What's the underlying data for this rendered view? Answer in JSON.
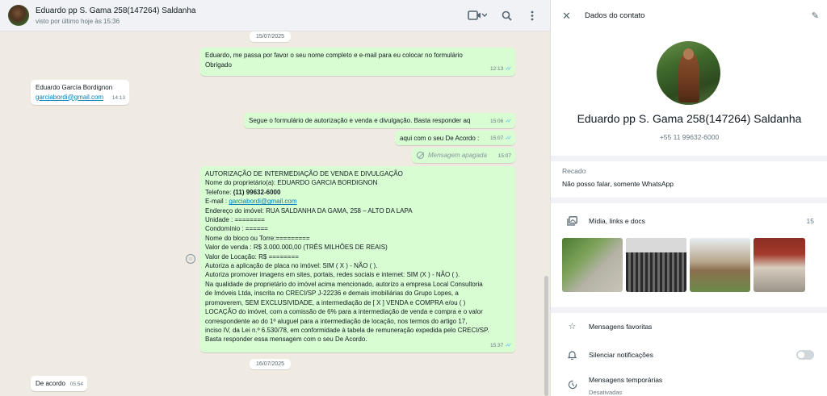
{
  "chat": {
    "title": "Eduardo pp S. Gama 258(147264) Saldanha",
    "last_seen": "visto por último hoje às 15:36",
    "dates": [
      "15/07/2025",
      "16/07/2025"
    ],
    "messages": [
      {
        "dir": "out",
        "lines": [
          "Eduardo,  me passa por favor o seu nome completo e e-mail para eu colocar no formulário",
          "Obrigado"
        ],
        "time": "12:13"
      },
      {
        "dir": "in",
        "name": "Eduardo García Bordignon",
        "email": "garciabordi@gmail.com",
        "time": "14:13"
      },
      {
        "dir": "out",
        "text": "Segue o formulário de autorização e venda e divulgação. Basta responder aq",
        "time": "15:06"
      },
      {
        "dir": "out",
        "text": "aqui com o seu De Acordo :",
        "time": "15:07"
      },
      {
        "dir": "out",
        "text": "Mensagem apagada",
        "time": "15:07"
      },
      {
        "dir": "out",
        "time": "15:37",
        "form": {
          "l1": "AUTORIZAÇÃO DE INTERMEDIAÇÃO DE VENDA E DIVULGAÇÃO",
          "l2": "Nome do proprietário(a):  EDUARDO GARCIA BORDIGNON",
          "l3a": "Telefone: ",
          "l3b": "(11) 99632-6000",
          "l4a": "E-mail : ",
          "l4b": "garciabordi@gmail.com",
          "l5": "Endereço do imóvel: RUA SALDANHA DA GAMA, 258 – ALTO DA LAPA",
          "l6": "Unidade : ========",
          "l7": "Condomínio :  ======",
          "l8": "Nome do bloco ou Torre:=========",
          "l9": "Valor de venda : R$ 3.000.000,00 (TRÊS MILHÕES DE REAIS)",
          "l10": "Valor de Locação: R$ ========",
          "l11": "Autoriza a aplicação de placa no imóvel: SIM (  X  ) - NÃO (    ).",
          "l12": "Autoriza promover imagens em sites, portais, redes sociais e internet: SIM (X ) - NÃO (   ).",
          "l13": "Na qualidade de proprietário do imóvel acima mencionado, autorizo a empresa Local Consultoria",
          "l14": "de Imóveis Ltda, inscrita no CRECI/SP J-22236 e demais imobiliárias do Grupo Lopes, a",
          "l15": "promoverem, SEM EXCLUSIVIDADE, a intermediação de [ X    ] VENDA e COMPRA e/ou (     )",
          "l16": "LOCAÇÃO do imóvel, com a comissão de 6% para a intermediação de venda e compra e o valor",
          "l17": "correspondente  ao do 1º aluguel para a intermediação de locação, nos termos do artigo 17,",
          "l18": "inciso IV, da Lei n.º 6.530/78, em conformidade à tabela de remuneração expedida pelo CRECI/SP.",
          "l19": "Basta responder essa mensagem com o seu De Acordo."
        }
      },
      {
        "dir": "in",
        "text": "De acordo",
        "time": "05:54"
      }
    ]
  },
  "contact": {
    "header_title": "Dados do contato",
    "name": "Eduardo pp S. Gama 258(147264) Saldanha",
    "phone": "+55 11 99632-6000",
    "recado_label": "Recado",
    "recado_text": "Não posso falar, somente WhatsApp",
    "media_label": "Mídia, links e docs",
    "media_count": "15",
    "favorites_label": "Mensagens favoritas",
    "mute_label": "Silenciar notificações",
    "mute_on": false,
    "temp_label": "Mensagens temporárias",
    "temp_status": "Desativadas"
  },
  "colors": {
    "outgoing": "#d9fdd3",
    "incoming": "#ffffff",
    "read_ticks": "#53bdeb",
    "link": "#027eb5"
  }
}
